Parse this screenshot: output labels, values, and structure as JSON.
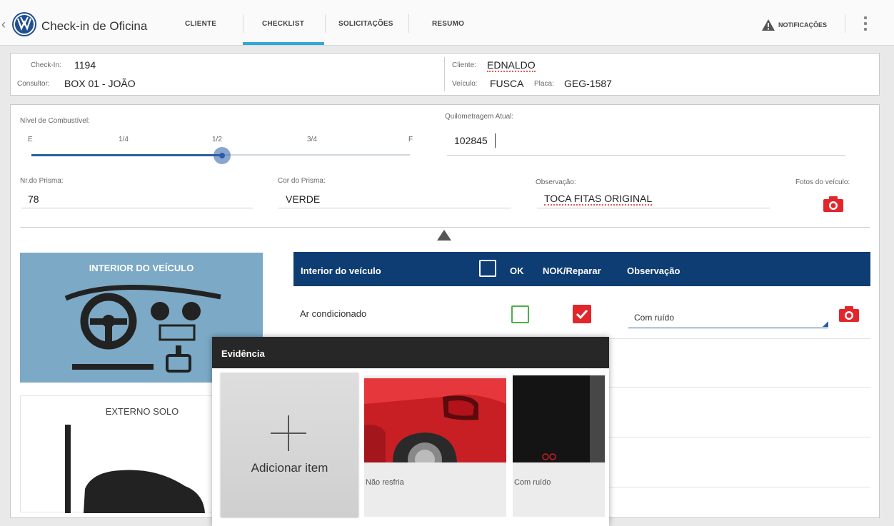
{
  "header": {
    "app_title": "Check-in de Oficina",
    "tabs": [
      {
        "label": "CLIENTE"
      },
      {
        "label": "CHECKLIST",
        "active": true
      },
      {
        "label": "SOLICITAÇÕES"
      },
      {
        "label": "RESUMO"
      }
    ],
    "notifications_label": "NOTIFICAÇÕES"
  },
  "info": {
    "checkin_label": "Check-In:",
    "checkin_value": "1194",
    "consultor_label": "Consultor:",
    "consultor_value": "BOX 01 - JOÃO",
    "cliente_label": "Cliente:",
    "cliente_value": "EDNALDO",
    "veiculo_label": "Veículo:",
    "veiculo_value": "FUSCA",
    "placa_label": "Placa:",
    "placa_value": "GEG-1587"
  },
  "form": {
    "fuel_label": "Nível de Combustível:",
    "fuel_ticks": [
      "E",
      "1/4",
      "1/2",
      "3/4",
      "F"
    ],
    "fuel_level": 0.5,
    "km_label": "Quilometragem Atual:",
    "km_value": "102845",
    "prisma_label": "Nr.do Prisma:",
    "prisma_value": "78",
    "cor_label": "Cor do Prisma:",
    "cor_value": "VERDE",
    "obs_label": "Observação:",
    "obs_value": "TOCA FITAS ORIGINAL",
    "fotos_label": "Fotos do veículo:"
  },
  "sections": {
    "interior_title": "INTERIOR DO VEÍCULO",
    "externo_title": "EXTERNO SOLO"
  },
  "table": {
    "title": "Interior do veículo",
    "col_ok": "OK",
    "col_nok": "NOK/Reparar",
    "col_obs": "Observação",
    "rows": [
      {
        "item": "Ar condicionado",
        "ok": false,
        "nok": true,
        "obs": "Com ruído"
      }
    ]
  },
  "dialog": {
    "title": "Evidência",
    "add_label": "Adicionar item",
    "photos": [
      {
        "caption": "Não resfria"
      },
      {
        "caption": "Com ruído"
      }
    ]
  },
  "colors": {
    "accent": "#33a6d8",
    "header_blue": "#0d3d73",
    "slider": "#2c5da5",
    "danger": "#e3262b",
    "ok_green": "#4cae4c",
    "interior_tile": "#7ba9c6"
  }
}
